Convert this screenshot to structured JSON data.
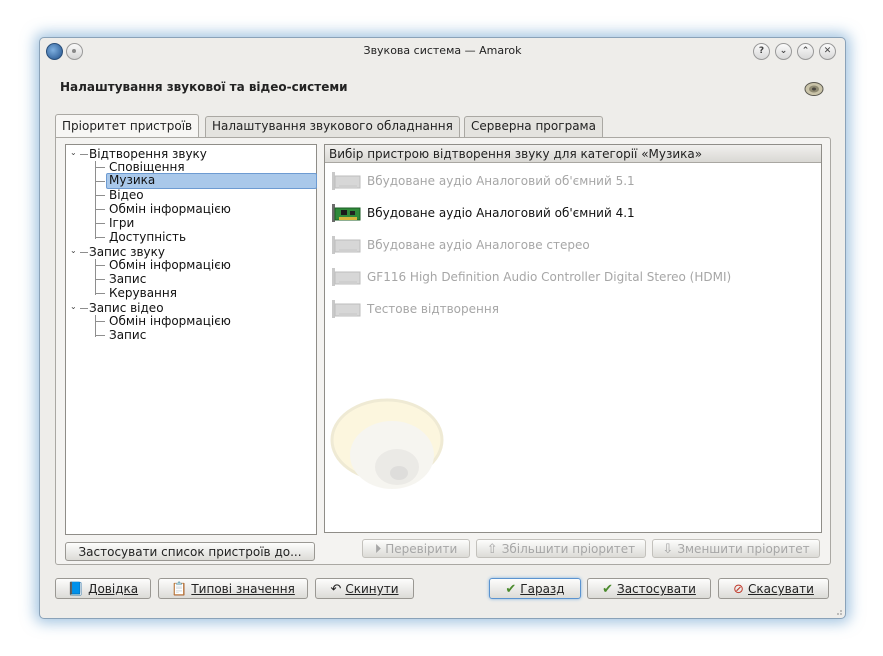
{
  "window": {
    "title": "Звукова система — Amarok"
  },
  "titlebar_controls": [
    "?",
    "⌄",
    "⌃",
    "✕"
  ],
  "page_title": "Налаштування звукової та відео-системи",
  "tabs": [
    {
      "label": "Пріоритет пристроїв"
    },
    {
      "label": "Налаштування звукового обладнання"
    },
    {
      "label": "Серверна програма"
    }
  ],
  "tree": {
    "g1": "Відтворення звуку",
    "g1_items": [
      "Сповіщення",
      "Музика",
      "Відео",
      "Обмін інформацією",
      "Ігри",
      "Доступність"
    ],
    "g2": "Запис звуку",
    "g2_items": [
      "Обмін інформацією",
      "Запис",
      "Керування"
    ],
    "g3": "Запис відео",
    "g3_items": [
      "Обмін інформацією",
      "Запис"
    ]
  },
  "device_list": {
    "header": "Вибір пристрою відтворення звуку для категорії «Музика»",
    "devices": [
      "Вбудоване аудіо Аналоговий об'ємний 5.1",
      "Вбудоване аудіо Аналоговий об'ємний 4.1",
      "Вбудоване аудіо Аналогове стерео",
      "GF116 High Definition Audio Controller Digital Stereo (HDMI)",
      "Тестове відтворення"
    ]
  },
  "buttons": {
    "apply_list": "Застосувати список пристроїв до...",
    "test": "Перевірити",
    "prefer": "Збільшити пріоритет",
    "defer": "Зменшити пріоритет",
    "help": "Довідка",
    "defaults": "Типові значення",
    "reset": "Скинути",
    "ok": "Гаразд",
    "apply": "Застосувати",
    "cancel": "Скасувати"
  },
  "colors": {
    "selection": "#a9c8ea",
    "accent": "#5b93cf",
    "disabled_text": "#a6a6a6",
    "glow": "#5a96c8"
  }
}
